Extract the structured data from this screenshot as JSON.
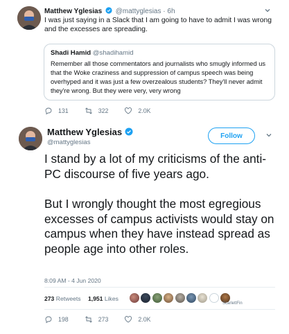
{
  "tweet1": {
    "author_name": "Matthew Yglesias",
    "author_handle": "@mattyglesias",
    "separator": "·",
    "time": "6h",
    "text": "I was just saying in a Slack that I am going to have to admit I was wrong and the excesses are spreading.",
    "quote": {
      "author_name": "Shadi Hamid",
      "author_handle": "@shadihamid",
      "text": "Remember all those commentators and journalists who smugly informed us that the Woke craziness and suppression of campus speech was being overhyped and it was just a few overzealous students? They'll never admit they're wrong. But they were very, very wrong"
    },
    "actions": {
      "replies": "131",
      "retweets": "322",
      "likes": "2.0K"
    }
  },
  "tweet2": {
    "author_name": "Matthew Yglesias",
    "author_handle": "@mattyglesias",
    "follow_label": "Follow",
    "paragraph1": "I stand by a lot of my criticisms of the anti-PC discourse of five years ago.",
    "paragraph2": "But I wrongly thought the most egregious excesses of campus activists would stay on campus when they have instead spread as people age into other roles.",
    "timestamp": "8:09 AM - 4 Jun 2020",
    "retweet_count": "273",
    "retweet_label": "Retweets",
    "like_count": "1,951",
    "like_label": "Likes",
    "liker_label": "ScarlettFin",
    "actions": {
      "replies": "198",
      "retweets": "273",
      "likes": "2.0K"
    }
  },
  "colors": {
    "accent": "#1da1f2",
    "text": "#14171a",
    "muted": "#657786",
    "border": "#ccd6dd"
  },
  "icons": [
    "verified-badge-icon",
    "chevron-down-icon",
    "reply-icon",
    "retweet-icon",
    "like-icon"
  ]
}
